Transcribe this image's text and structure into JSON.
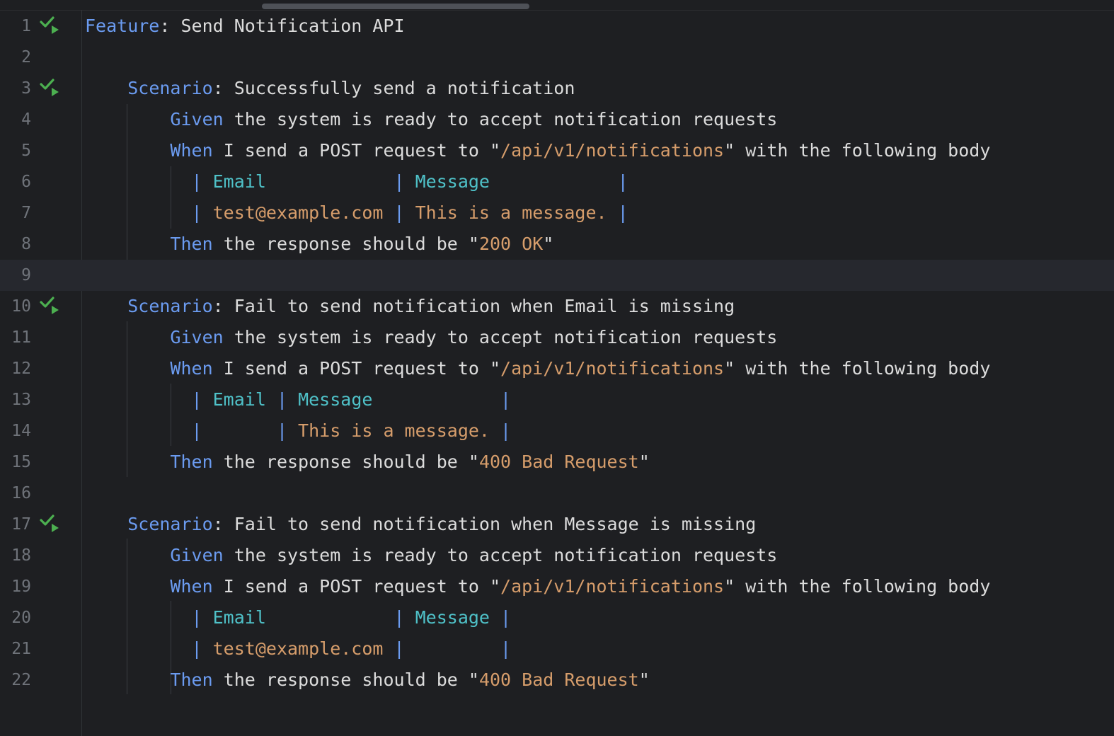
{
  "editor": {
    "lines": [
      {
        "n": "1",
        "run": true,
        "tokens": [
          [
            "kw",
            "Feature"
          ],
          [
            "txt",
            ": Send Notification API"
          ]
        ]
      },
      {
        "n": "2",
        "run": false,
        "tokens": []
      },
      {
        "n": "3",
        "run": true,
        "tokens": [
          [
            "txt",
            "    "
          ],
          [
            "kw",
            "Scenario"
          ],
          [
            "txt",
            ": Successfully send a notification"
          ]
        ]
      },
      {
        "n": "4",
        "run": false,
        "tokens": [
          [
            "txt",
            "        "
          ],
          [
            "kw",
            "Given"
          ],
          [
            "txt",
            " the system is ready to accept notification requests"
          ]
        ]
      },
      {
        "n": "5",
        "run": false,
        "tokens": [
          [
            "txt",
            "        "
          ],
          [
            "kw",
            "When"
          ],
          [
            "txt",
            " I send a POST request to \""
          ],
          [
            "str",
            "/api/v1/notifications"
          ],
          [
            "txt",
            "\" with the following body"
          ]
        ]
      },
      {
        "n": "6",
        "run": false,
        "tokens": [
          [
            "txt",
            "          "
          ],
          [
            "pipe",
            "| "
          ],
          [
            "hdr",
            "Email"
          ],
          [
            "txt",
            "            "
          ],
          [
            "pipe",
            "| "
          ],
          [
            "hdr",
            "Message"
          ],
          [
            "txt",
            "            "
          ],
          [
            "pipe",
            "|"
          ]
        ]
      },
      {
        "n": "7",
        "run": false,
        "tokens": [
          [
            "txt",
            "          "
          ],
          [
            "pipe",
            "| "
          ],
          [
            "cell",
            "test@example.com"
          ],
          [
            "txt",
            " "
          ],
          [
            "pipe",
            "| "
          ],
          [
            "cell",
            "This is a message."
          ],
          [
            "txt",
            " "
          ],
          [
            "pipe",
            "|"
          ]
        ]
      },
      {
        "n": "8",
        "run": false,
        "tokens": [
          [
            "txt",
            "        "
          ],
          [
            "kw",
            "Then"
          ],
          [
            "txt",
            " the response should be \""
          ],
          [
            "str",
            "200 OK"
          ],
          [
            "txt",
            "\""
          ]
        ]
      },
      {
        "n": "9",
        "run": false,
        "current": true,
        "tokens": []
      },
      {
        "n": "10",
        "run": true,
        "tokens": [
          [
            "txt",
            "    "
          ],
          [
            "kw",
            "Scenario"
          ],
          [
            "txt",
            ": Fail to send notification when Email is missing"
          ]
        ]
      },
      {
        "n": "11",
        "run": false,
        "tokens": [
          [
            "txt",
            "        "
          ],
          [
            "kw",
            "Given"
          ],
          [
            "txt",
            " the system is ready to accept notification requests"
          ]
        ]
      },
      {
        "n": "12",
        "run": false,
        "tokens": [
          [
            "txt",
            "        "
          ],
          [
            "kw",
            "When"
          ],
          [
            "txt",
            " I send a POST request to \""
          ],
          [
            "str",
            "/api/v1/notifications"
          ],
          [
            "txt",
            "\" with the following body"
          ]
        ]
      },
      {
        "n": "13",
        "run": false,
        "tokens": [
          [
            "txt",
            "          "
          ],
          [
            "pipe",
            "| "
          ],
          [
            "hdr",
            "Email"
          ],
          [
            "txt",
            " "
          ],
          [
            "pipe",
            "| "
          ],
          [
            "hdr",
            "Message"
          ],
          [
            "txt",
            "            "
          ],
          [
            "pipe",
            "|"
          ]
        ]
      },
      {
        "n": "14",
        "run": false,
        "tokens": [
          [
            "txt",
            "          "
          ],
          [
            "pipe",
            "|"
          ],
          [
            "txt",
            "       "
          ],
          [
            "pipe",
            "| "
          ],
          [
            "cell",
            "This is a message."
          ],
          [
            "txt",
            " "
          ],
          [
            "pipe",
            "|"
          ]
        ]
      },
      {
        "n": "15",
        "run": false,
        "tokens": [
          [
            "txt",
            "        "
          ],
          [
            "kw",
            "Then"
          ],
          [
            "txt",
            " the response should be \""
          ],
          [
            "str",
            "400 Bad Request"
          ],
          [
            "txt",
            "\""
          ]
        ]
      },
      {
        "n": "16",
        "run": false,
        "tokens": []
      },
      {
        "n": "17",
        "run": true,
        "tokens": [
          [
            "txt",
            "    "
          ],
          [
            "kw",
            "Scenario"
          ],
          [
            "txt",
            ": Fail to send notification when Message is missing"
          ]
        ]
      },
      {
        "n": "18",
        "run": false,
        "tokens": [
          [
            "txt",
            "        "
          ],
          [
            "kw",
            "Given"
          ],
          [
            "txt",
            " the system is ready to accept notification requests"
          ]
        ]
      },
      {
        "n": "19",
        "run": false,
        "tokens": [
          [
            "txt",
            "        "
          ],
          [
            "kw",
            "When"
          ],
          [
            "txt",
            " I send a POST request to \""
          ],
          [
            "str",
            "/api/v1/notifications"
          ],
          [
            "txt",
            "\" with the following body"
          ]
        ]
      },
      {
        "n": "20",
        "run": false,
        "tokens": [
          [
            "txt",
            "          "
          ],
          [
            "pipe",
            "| "
          ],
          [
            "hdr",
            "Email"
          ],
          [
            "txt",
            "            "
          ],
          [
            "pipe",
            "| "
          ],
          [
            "hdr",
            "Message"
          ],
          [
            "txt",
            " "
          ],
          [
            "pipe",
            "|"
          ]
        ]
      },
      {
        "n": "21",
        "run": false,
        "tokens": [
          [
            "txt",
            "          "
          ],
          [
            "pipe",
            "| "
          ],
          [
            "cell",
            "test@example.com"
          ],
          [
            "txt",
            " "
          ],
          [
            "pipe",
            "|"
          ],
          [
            "txt",
            "         "
          ],
          [
            "pipe",
            "|"
          ]
        ]
      },
      {
        "n": "22",
        "run": false,
        "tokens": [
          [
            "txt",
            "        "
          ],
          [
            "kw",
            "Then"
          ],
          [
            "txt",
            " the response should be \""
          ],
          [
            "str",
            "400 Bad Request"
          ],
          [
            "txt",
            "\""
          ]
        ]
      }
    ]
  },
  "colors": {
    "keyword": "#6b9bf0",
    "string": "#d69d6b",
    "table_header": "#4fc1c8",
    "run_icon": "#4caf50",
    "background": "#1e1f22"
  },
  "icons": {
    "run_gutter": "run-test-check-icon"
  }
}
